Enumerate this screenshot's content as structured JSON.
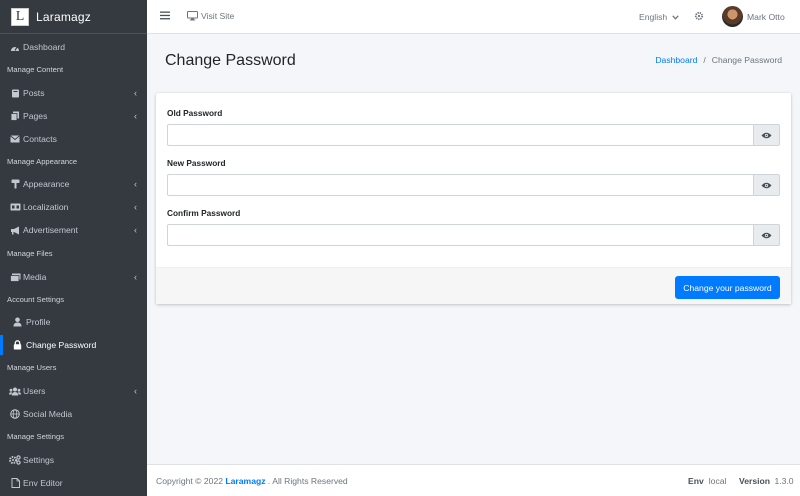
{
  "app": {
    "brand_letter": "L",
    "brand_name": "Laramagz"
  },
  "topbar": {
    "visit_site": "Visit Site",
    "language": "English",
    "user_name": "Mark Otto"
  },
  "sidebar": {
    "dashboard": "Dashboard",
    "manage_content": "Manage Content",
    "posts": "Posts",
    "pages": "Pages",
    "contacts": "Contacts",
    "manage_appearance": "Manage Appearance",
    "appearance": "Appearance",
    "localization": "Localization",
    "advertisement": "Advertisement",
    "manage_files": "Manage Files",
    "media": "Media",
    "account_settings": "Account Settings",
    "profile": "Profile",
    "change_password": "Change Password",
    "manage_users": "Manage Users",
    "users": "Users",
    "social_media": "Social Media",
    "manage_settings": "Manage Settings",
    "settings": "Settings",
    "env_editor": "Env Editor"
  },
  "page": {
    "title": "Change Password",
    "breadcrumb_home": "Dashboard",
    "breadcrumb_sep": "/",
    "breadcrumb_current": "Change Password"
  },
  "form": {
    "old_label": "Old Password",
    "old_value": "",
    "new_label": "New Password",
    "new_value": "",
    "confirm_label": "Confirm Password",
    "confirm_value": "",
    "submit": "Change your password"
  },
  "footer": {
    "copyright_prefix": "Copyright © 2022",
    "copyright_brand": "Laramagz",
    "copyright_suffix": ". All Rights Reserved",
    "env_label": "Env",
    "env_value": "local",
    "version_label": "Version",
    "version_value": "1.3.0"
  },
  "colors": {
    "sidebar_bg": "#343a40",
    "accent": "#007bff",
    "content_bg": "#f4f6f9"
  },
  "icons": [
    "menu-icon",
    "desktop-icon",
    "chevron-down-icon",
    "gear-icon",
    "dashboard-icon",
    "book-icon",
    "copy-icon",
    "envelope-icon",
    "paint-roller-icon",
    "language-icon",
    "bullhorn-icon",
    "photo-video-icon",
    "user-icon",
    "lock-icon",
    "users-icon",
    "globe-icon",
    "cogs-icon",
    "file-icon",
    "eye-icon",
    "chevron-left-icon"
  ]
}
